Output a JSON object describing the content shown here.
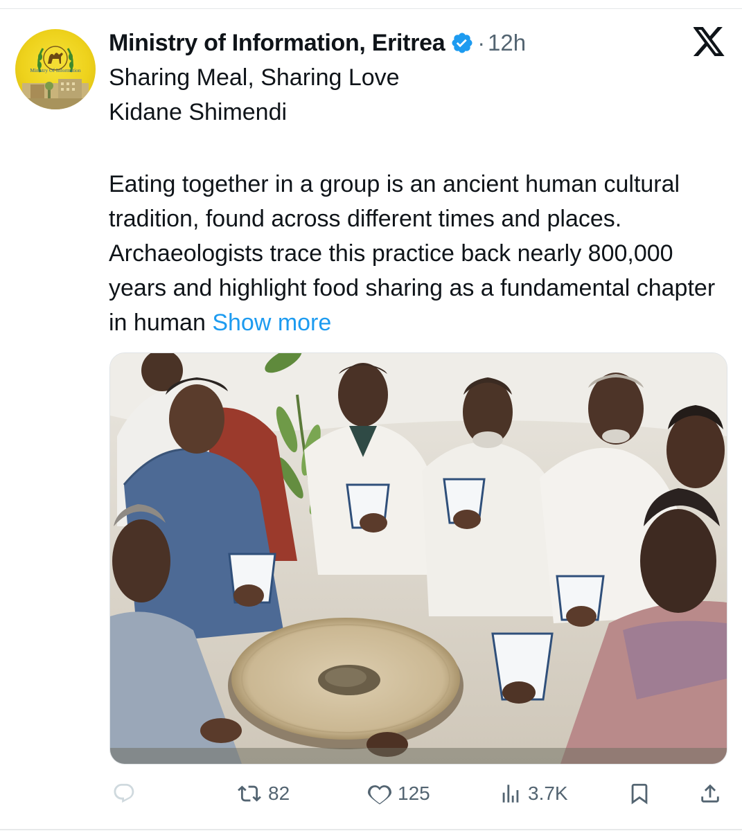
{
  "post": {
    "author_name": "Ministry of Information, Eritrea",
    "separator": "·",
    "time": "12h",
    "line1": "Sharing Meal, Sharing Love",
    "line2": "Kidane Shimendi",
    "body": "Eating together in a group is an ancient human cultural tradition, found across different times and places. Archaeologists trace this practice back nearly 800,000 years and highlight food sharing as a fundamental chapter in human",
    "show_more": "Show more",
    "avatar_text": "Ministry Of Information",
    "verified": true
  },
  "actions": {
    "reply": {
      "icon": "reply-icon",
      "count": ""
    },
    "repost": {
      "icon": "repost-icon",
      "count": "82"
    },
    "like": {
      "icon": "heart-icon",
      "count": "125"
    },
    "views": {
      "icon": "views-icon",
      "count": "3.7K"
    },
    "bookmark": {
      "icon": "bookmark-icon"
    },
    "share": {
      "icon": "share-icon"
    }
  },
  "colors": {
    "accent": "#1d9bf0",
    "text": "#0f1419",
    "secondary": "#536471",
    "avatar_yellow": "#eed21c",
    "reply_icon": "#cfd9de"
  }
}
